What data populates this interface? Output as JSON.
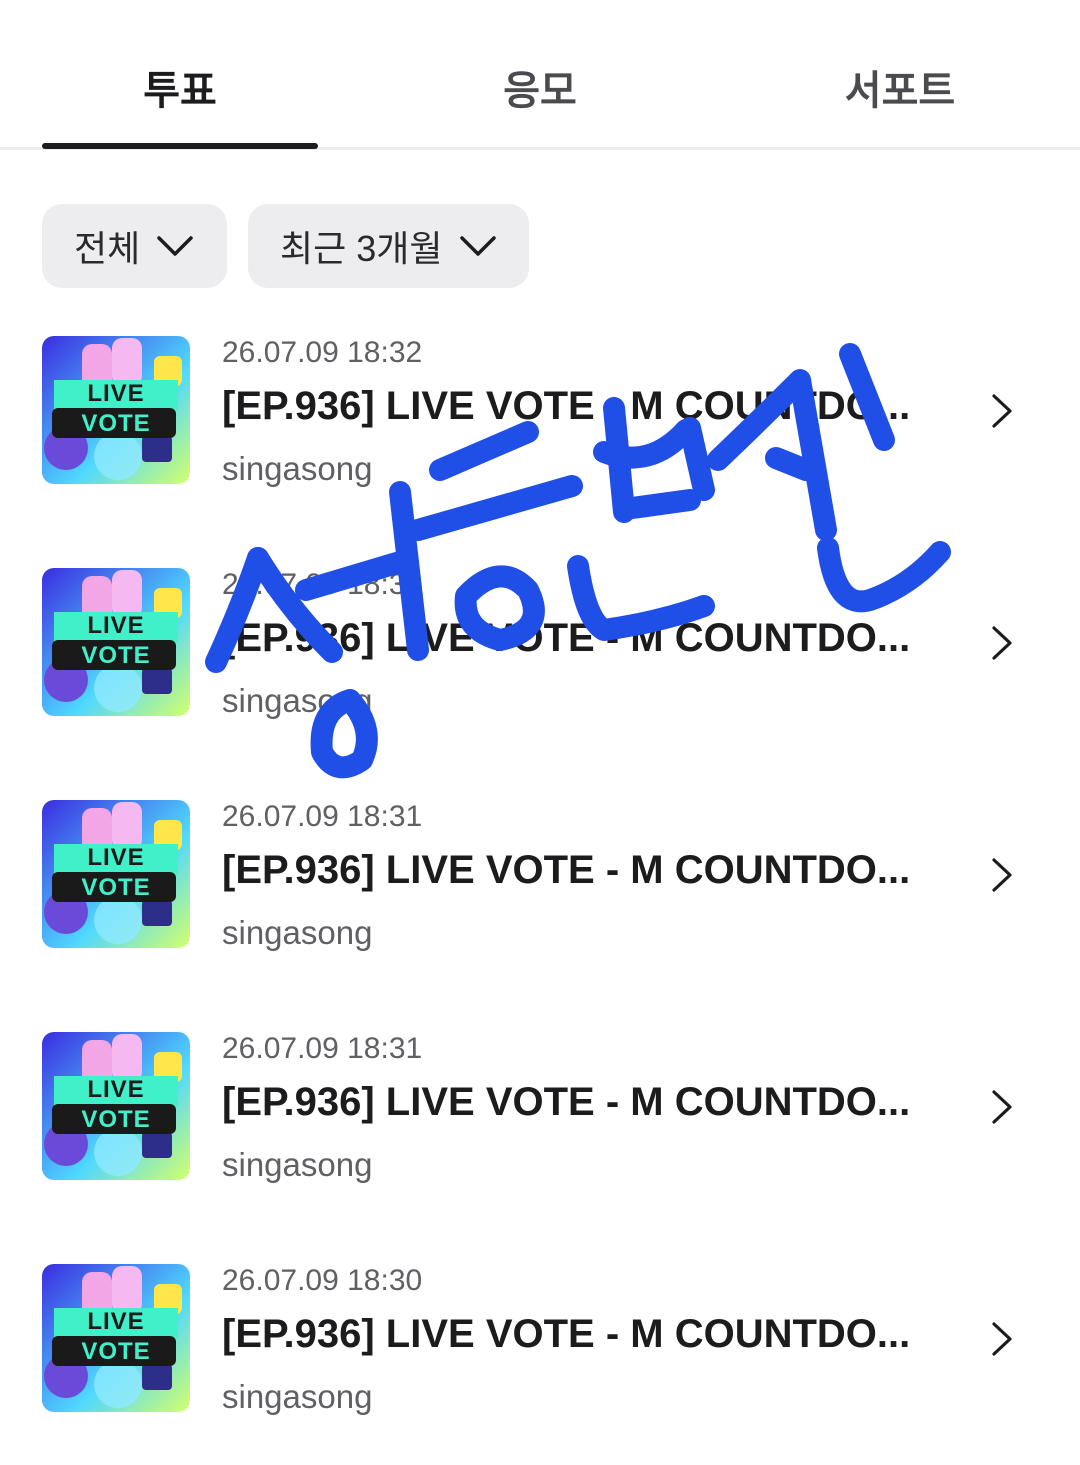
{
  "tabs": [
    {
      "label": "투표",
      "active": true
    },
    {
      "label": "응모",
      "active": false
    },
    {
      "label": "서포트",
      "active": false
    }
  ],
  "filters": {
    "category": "전체",
    "period": "최근 3개월"
  },
  "items": [
    {
      "date": "26.07.09 18:32",
      "title": "[EP.936] LIVE VOTE - M COUNTDO...",
      "author": "singasong",
      "thumb_line1": "LIVE",
      "thumb_line2": "VOTE"
    },
    {
      "date": "26.07.09 18:31",
      "title": "[EP.936] LIVE VOTE - M COUNTDO...",
      "author": "singasong",
      "thumb_line1": "LIVE",
      "thumb_line2": "VOTE"
    },
    {
      "date": "26.07.09 18:31",
      "title": "[EP.936] LIVE VOTE - M COUNTDO...",
      "author": "singasong",
      "thumb_line1": "LIVE",
      "thumb_line2": "VOTE"
    },
    {
      "date": "26.07.09 18:31",
      "title": "[EP.936] LIVE VOTE - M COUNTDO...",
      "author": "singasong",
      "thumb_line1": "LIVE",
      "thumb_line2": "VOTE"
    },
    {
      "date": "26.07.09 18:30",
      "title": "[EP.936] LIVE VOTE - M COUNTDO...",
      "author": "singasong",
      "thumb_line1": "LIVE",
      "thumb_line2": "VOTE"
    }
  ],
  "icons": {
    "dropdown": "chevron-down-icon",
    "item_arrow": "chevron-right-icon"
  },
  "colors": {
    "scribble": "#1f4fe6",
    "text_primary": "#1c1c1e",
    "text_secondary": "#5f5f64",
    "filter_bg": "#ededf0"
  }
}
